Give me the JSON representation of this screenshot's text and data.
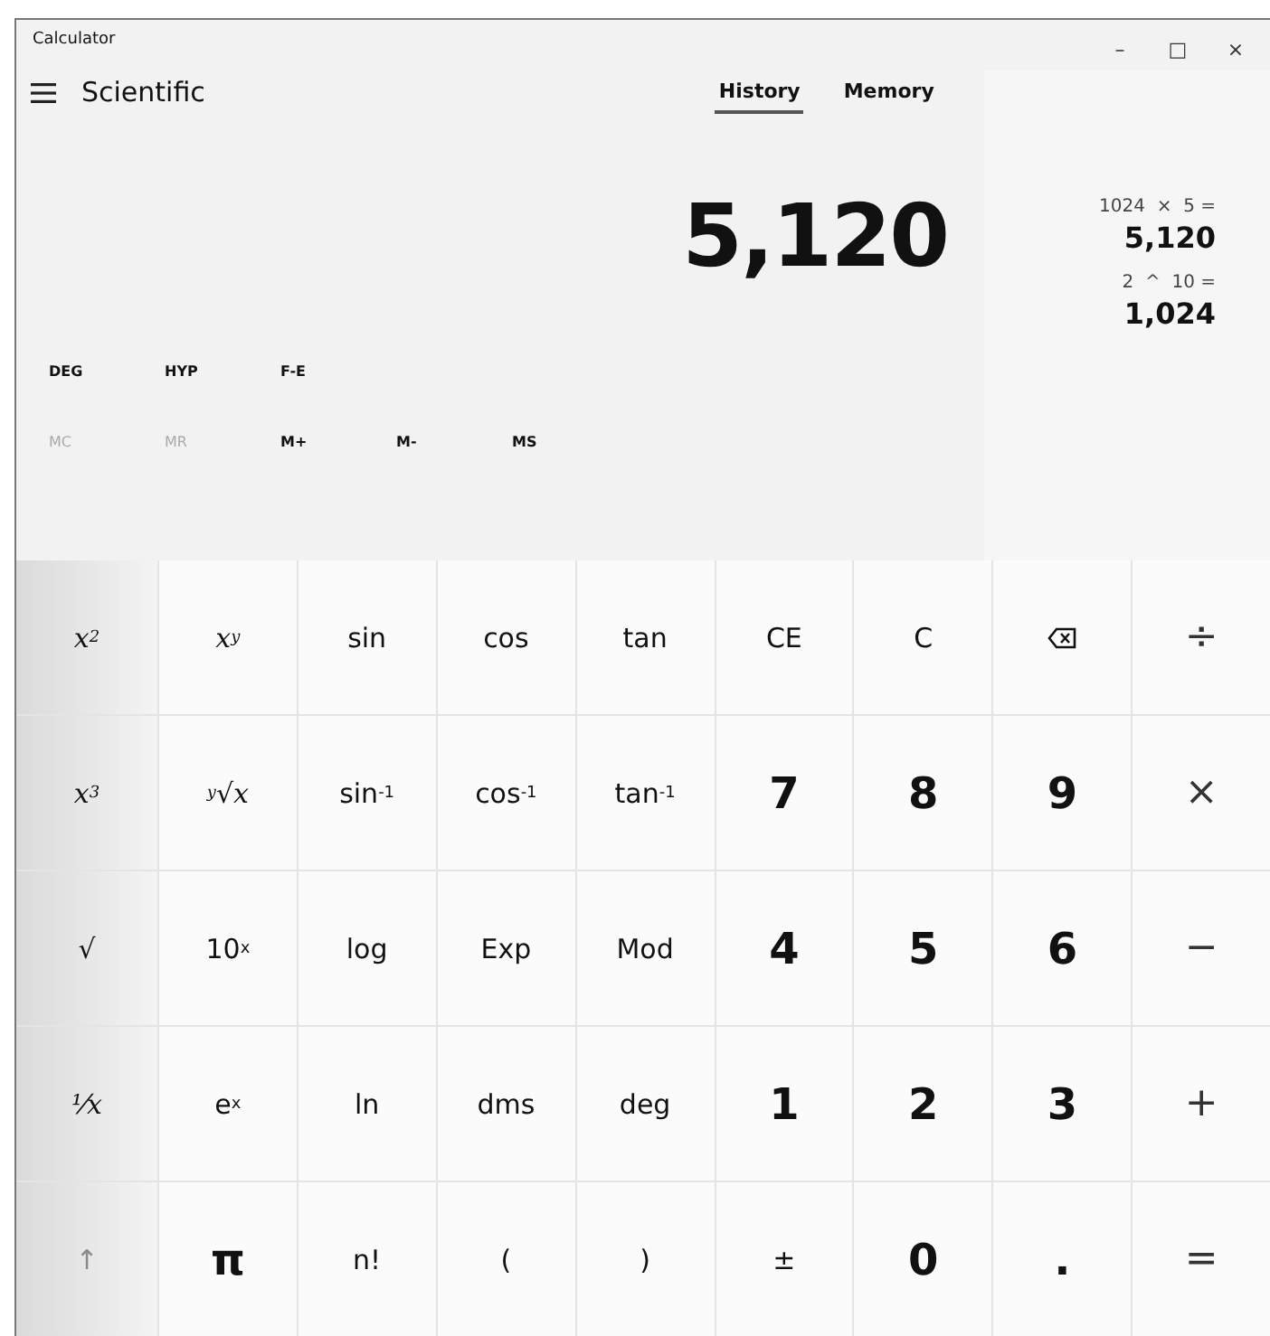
{
  "window": {
    "title": "Calculator",
    "controls": [
      "–",
      "□",
      "×"
    ]
  },
  "header": {
    "mode": "Scientific"
  },
  "tabs": [
    {
      "label": "History",
      "selected": true
    },
    {
      "label": "Memory",
      "selected": false
    }
  ],
  "display": "5,120",
  "history": [
    {
      "expression": "1024  ×  5 =",
      "result": "5,120"
    },
    {
      "expression": "2  ^  10 =",
      "result": "1,024"
    }
  ],
  "angle_row": [
    "DEG",
    "HYP",
    "F-E"
  ],
  "memory_buttons": [
    {
      "label": "MC",
      "disabled": true
    },
    {
      "label": "MR",
      "disabled": true
    },
    {
      "label": "M+",
      "disabled": false
    },
    {
      "label": "M-",
      "disabled": false
    },
    {
      "label": "MS",
      "disabled": false
    }
  ],
  "keys": [
    {
      "kind": "math",
      "label": "x$^{2}$",
      "disabled": false
    },
    {
      "kind": "math",
      "label": "x$^{y}$",
      "disabled": false
    },
    {
      "kind": "fn",
      "label": "sin",
      "disabled": false
    },
    {
      "kind": "fn",
      "label": "cos",
      "disabled": false
    },
    {
      "kind": "fn",
      "label": "tan",
      "disabled": false
    },
    {
      "kind": "fn",
      "label": "CE",
      "disabled": false
    },
    {
      "kind": "fn",
      "label": "C",
      "disabled": false
    },
    {
      "kind": "backspace",
      "disabled": false
    },
    {
      "kind": "op",
      "label": "÷",
      "disabled": false
    },
    {
      "kind": "math",
      "label": "x$^{3}$",
      "disabled": false
    },
    {
      "kind": "math",
      "label": "$^{y}$√x",
      "disabled": false
    },
    {
      "kind": "fn",
      "label": "sin$^{-1}$",
      "disabled": false
    },
    {
      "kind": "fn",
      "label": "cos$^{-1}$",
      "disabled": false
    },
    {
      "kind": "fn",
      "label": "tan$^{-1}$",
      "disabled": false
    },
    {
      "kind": "num",
      "label": "7",
      "disabled": false
    },
    {
      "kind": "num",
      "label": "8",
      "disabled": false
    },
    {
      "kind": "num",
      "label": "9",
      "disabled": false
    },
    {
      "kind": "op",
      "label": "×",
      "disabled": false
    },
    {
      "kind": "math",
      "label": "√",
      "disabled": false
    },
    {
      "kind": "fn",
      "label": "10$^{x}$",
      "disabled": false
    },
    {
      "kind": "fn",
      "label": "log",
      "disabled": false
    },
    {
      "kind": "fn",
      "label": "Exp",
      "disabled": false
    },
    {
      "kind": "fn",
      "label": "Mod",
      "disabled": false
    },
    {
      "kind": "num",
      "label": "4",
      "disabled": false
    },
    {
      "kind": "num",
      "label": "5",
      "disabled": false
    },
    {
      "kind": "num",
      "label": "6",
      "disabled": false
    },
    {
      "kind": "op",
      "label": "−",
      "disabled": false
    },
    {
      "kind": "math",
      "label": "¹⁄x",
      "disabled": false
    },
    {
      "kind": "fn",
      "label": "e$^{x}$",
      "disabled": false
    },
    {
      "kind": "fn",
      "label": "ln",
      "disabled": false
    },
    {
      "kind": "fn",
      "label": "dms",
      "disabled": false
    },
    {
      "kind": "fn",
      "label": "deg",
      "disabled": false
    },
    {
      "kind": "num",
      "label": "1",
      "disabled": false
    },
    {
      "kind": "num",
      "label": "2",
      "disabled": false
    },
    {
      "kind": "num",
      "label": "3",
      "disabled": false
    },
    {
      "kind": "op",
      "label": "+",
      "disabled": false
    },
    {
      "kind": "fn",
      "label": "↑",
      "disabled": true
    },
    {
      "kind": "num",
      "label": "π",
      "disabled": false
    },
    {
      "kind": "fn",
      "label": "n!",
      "disabled": false
    },
    {
      "kind": "fn",
      "label": "(",
      "disabled": false
    },
    {
      "kind": "fn",
      "label": ")",
      "disabled": false
    },
    {
      "kind": "fn",
      "label": "±",
      "disabled": false
    },
    {
      "kind": "num",
      "label": "0",
      "disabled": false
    },
    {
      "kind": "num",
      "label": ".",
      "disabled": false
    },
    {
      "kind": "op",
      "label": "=",
      "disabled": false
    }
  ]
}
